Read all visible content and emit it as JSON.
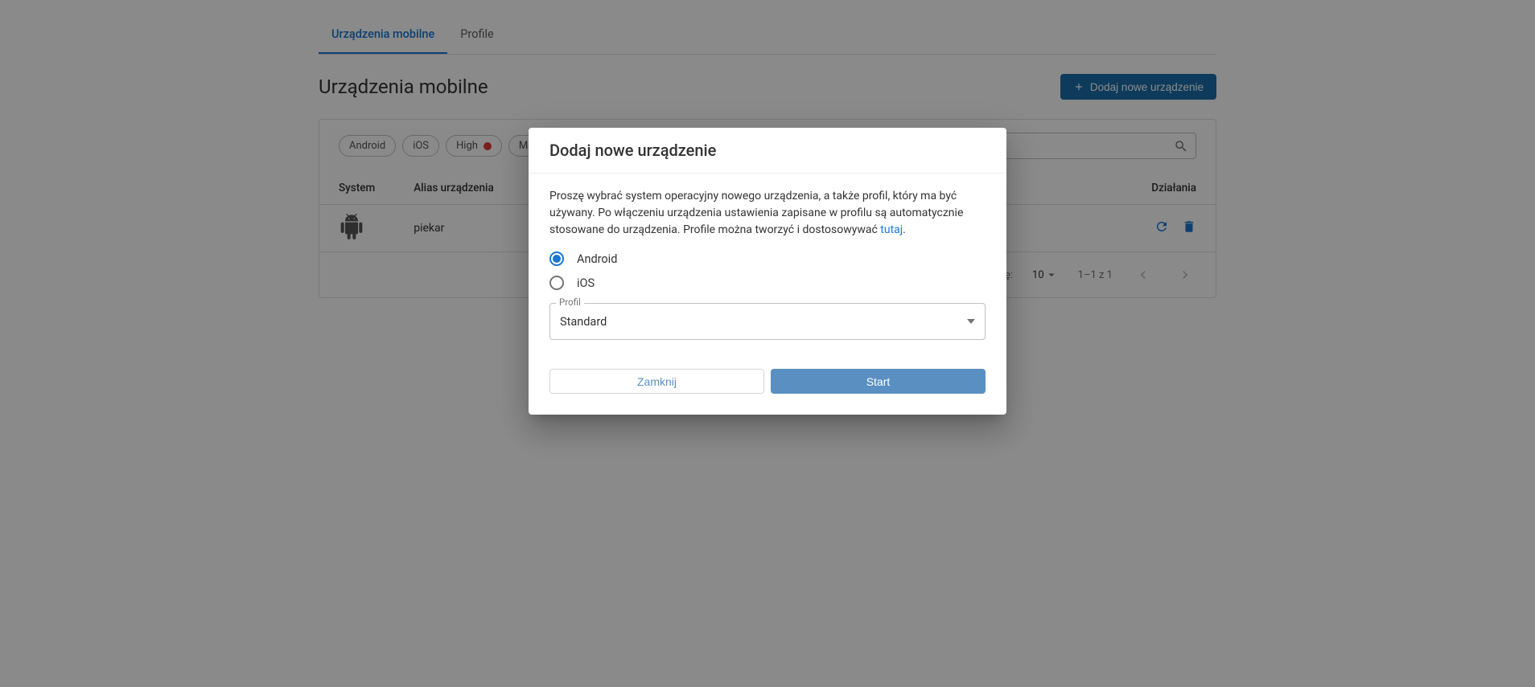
{
  "tabs": {
    "devices": "Urządzenia mobilne",
    "profile": "Profile"
  },
  "header": {
    "title": "Urządzenia mobilne",
    "add_button": "Dodaj nowe urządzenie"
  },
  "chips": {
    "android": "Android",
    "ios": "iOS",
    "high": "High",
    "medium": "Medium"
  },
  "search": {
    "placeholder": ""
  },
  "table": {
    "headers": {
      "system": "System",
      "alias": "Alias urządzenia",
      "actions": "Działania"
    },
    "rows": [
      {
        "alias": "piekar"
      }
    ]
  },
  "pagination": {
    "per_page_label": "Wierszy na stronę:",
    "per_page_value": "10",
    "range": "1–1 z 1"
  },
  "modal": {
    "title": "Dodaj nowe urządzenie",
    "description_prefix": "Proszę wybrać system operacyjny nowego urządzenia, a także profil, który ma być używany. Po włączeniu urządzenia ustawienia zapisane w profilu są automatycznie stosowane do urządzenia. Profile można tworzyć i dostosowywać ",
    "description_link": "tutaj",
    "description_suffix": ".",
    "option_android": "Android",
    "option_ios": "iOS",
    "profile_label": "Profil",
    "profile_value": "Standard",
    "close": "Zamknij",
    "start": "Start"
  }
}
